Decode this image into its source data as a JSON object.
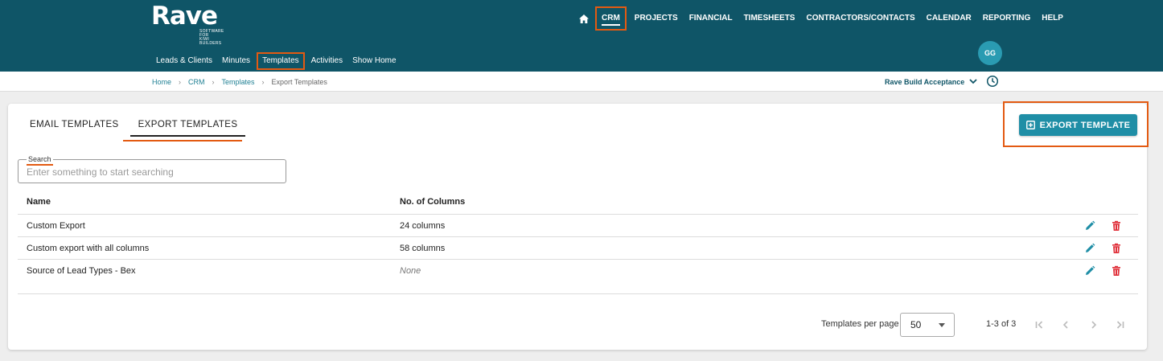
{
  "brand": {
    "name": "Rave",
    "tagline_line1": "SOFTWARE FOR",
    "tagline_line2": "KIWI BUILDERS"
  },
  "main_nav": {
    "items": [
      {
        "label": "CRM",
        "active": true
      },
      {
        "label": "PROJECTS"
      },
      {
        "label": "FINANCIAL"
      },
      {
        "label": "TIMESHEETS"
      },
      {
        "label": "CONTRACTORS/CONTACTS"
      },
      {
        "label": "CALENDAR"
      },
      {
        "label": "REPORTING"
      },
      {
        "label": "HELP"
      }
    ]
  },
  "sub_nav": {
    "items": [
      {
        "label": "Leads & Clients"
      },
      {
        "label": "Minutes"
      },
      {
        "label": "Templates",
        "active": true
      },
      {
        "label": "Activities"
      },
      {
        "label": "Show Home"
      }
    ]
  },
  "user": {
    "initials": "GG"
  },
  "breadcrumb": {
    "items": [
      "Home",
      "CRM",
      "Templates"
    ],
    "current": "Export Templates"
  },
  "project": {
    "name": "Rave Build Acceptance"
  },
  "tabs": [
    {
      "label": "EMAIL TEMPLATES",
      "active": false
    },
    {
      "label": "EXPORT TEMPLATES",
      "active": true
    }
  ],
  "actions": {
    "export_template_label": "EXPORT TEMPLATE"
  },
  "search": {
    "label": "Search",
    "placeholder": "Enter something to start searching",
    "value": ""
  },
  "table": {
    "columns": [
      "Name",
      "No. of Columns"
    ],
    "rows": [
      {
        "name": "Custom Export",
        "columns": "24 columns"
      },
      {
        "name": "Custom export with all columns",
        "columns": "58 columns"
      },
      {
        "name": "Source of Lead Types - Bex",
        "columns": "None"
      }
    ]
  },
  "pagination": {
    "per_page_label": "Templates per page",
    "per_page_value": "50",
    "range": "1-3 of 3"
  },
  "colors": {
    "header": "#0f5567",
    "accent": "#1f8ea6",
    "highlight": "#e35a12",
    "delete": "#e0313b"
  }
}
